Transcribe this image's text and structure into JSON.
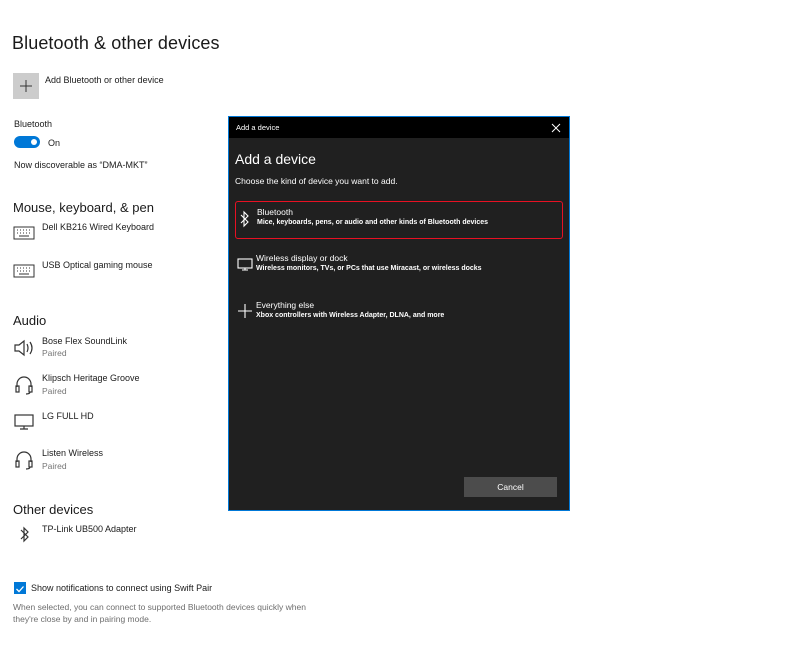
{
  "settings": {
    "title": "Bluetooth & other devices",
    "add_device_label": "Add Bluetooth or other device",
    "bluetooth_label": "Bluetooth",
    "toggle_state": "On",
    "discoverable": "Now discoverable as “DMA-MKT”",
    "sections": {
      "mouse": "Mouse, keyboard, & pen",
      "audio": "Audio",
      "other": "Other devices"
    },
    "mouse_devices": [
      {
        "name": "Dell KB216 Wired Keyboard",
        "icon": "keyboard-icon"
      },
      {
        "name": "USB Optical gaming mouse",
        "icon": "keyboard-icon"
      }
    ],
    "audio_devices": [
      {
        "name": "Bose Flex SoundLink",
        "status": "Paired",
        "icon": "speaker-icon"
      },
      {
        "name": "Klipsch Heritage Groove",
        "status": "Paired",
        "icon": "headset-icon"
      },
      {
        "name": "LG FULL HD",
        "status": "",
        "icon": "monitor-icon"
      },
      {
        "name": "Listen Wireless",
        "status": "Paired",
        "icon": "headset-icon"
      }
    ],
    "other_devices": [
      {
        "name": "TP-Link UB500 Adapter",
        "icon": "bluetooth-icon"
      }
    ],
    "swift_pair_label": "Show notifications to connect using Swift Pair",
    "swift_pair_note": "When selected, you can connect to supported Bluetooth devices quickly when they're close by and in pairing mode."
  },
  "dialog": {
    "window_title": "Add a device",
    "heading": "Add a device",
    "prompt": "Choose the kind of device you want to add.",
    "options": [
      {
        "title": "Bluetooth",
        "desc": "Mice, keyboards, pens, or audio and other kinds of Bluetooth devices",
        "icon": "bluetooth-icon"
      },
      {
        "title": "Wireless display or dock",
        "desc": "Wireless monitors, TVs, or PCs that use Miracast, or wireless docks",
        "icon": "monitor-icon"
      },
      {
        "title": "Everything else",
        "desc": "Xbox controllers with Wireless Adapter, DLNA, and more",
        "icon": "plus-icon"
      }
    ],
    "cancel_label": "Cancel"
  },
  "colors": {
    "accent": "#0078d7",
    "dialog_bg": "#202020",
    "selection_border": "#e81123"
  }
}
